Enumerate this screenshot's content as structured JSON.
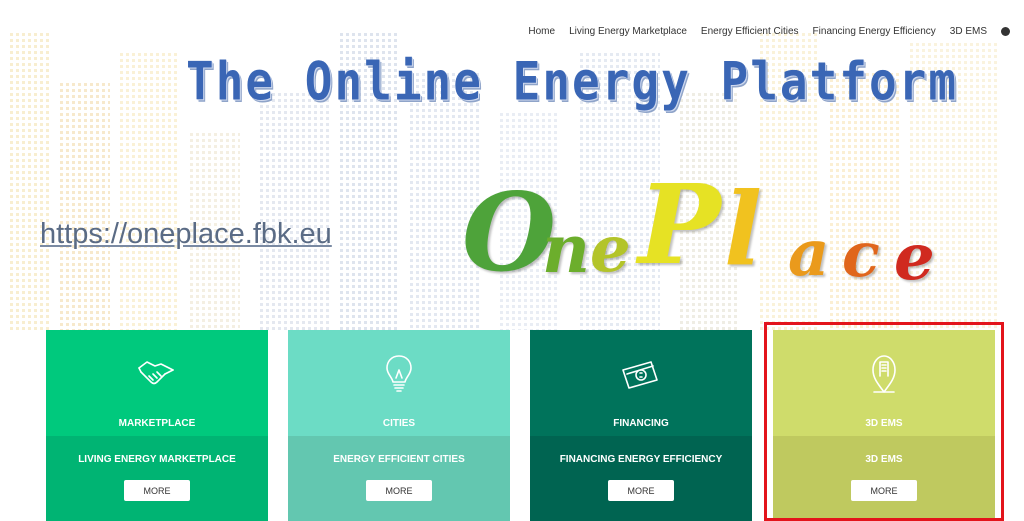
{
  "nav": {
    "items": [
      "Home",
      "Living Energy Marketplace",
      "Energy Efficient Cities",
      "Financing Energy Efficiency",
      "3D EMS"
    ],
    "globe_icon": "globe-icon"
  },
  "header": {
    "title": "The Online Energy Platform",
    "url": "https://oneplace.fbk.eu",
    "logo_letters": [
      "O",
      "n",
      "e",
      "P",
      "l",
      "a",
      "c",
      "e"
    ]
  },
  "cards": [
    {
      "category": "MARKETPLACE",
      "title": "LIVING ENERGY MARKETPLACE",
      "button": "MORE",
      "icon": "handshake-icon",
      "top_color": "#00c97d",
      "bottom_color": "#00b473"
    },
    {
      "category": "CITIES",
      "title": "ENERGY EFFICIENT CITIES",
      "button": "MORE",
      "icon": "lightbulb-icon",
      "top_color": "#6cdcc5",
      "bottom_color": "#63c7b0"
    },
    {
      "category": "FINANCING",
      "title": "FINANCING ENERGY EFFICIENCY",
      "button": "MORE",
      "icon": "money-icon",
      "top_color": "#00735b",
      "bottom_color": "#006451"
    },
    {
      "category": "3D EMS",
      "title": "3D EMS",
      "button": "MORE",
      "icon": "map-pin-building-icon",
      "top_color": "#cfdc6b",
      "bottom_color": "#bfc95f"
    }
  ],
  "highlight_color": "#e3141b"
}
